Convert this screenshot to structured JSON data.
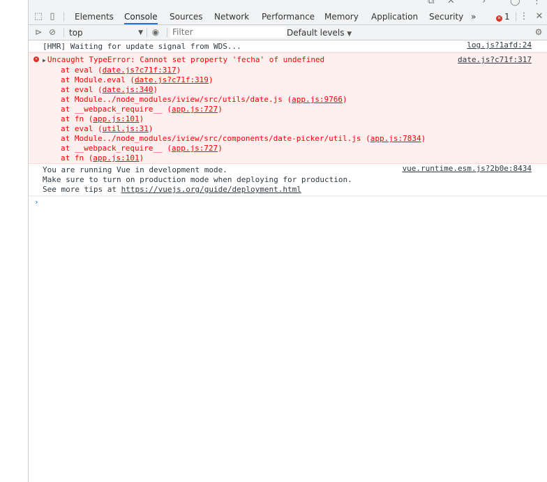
{
  "tabs": [
    "Elements",
    "Console",
    "Sources",
    "Network",
    "Performance",
    "Memory",
    "Application",
    "Security"
  ],
  "more_tabs": "»",
  "error_count": "1",
  "context": "top",
  "filter_placeholder": "Filter",
  "levels": "Default levels",
  "messages": {
    "hmr": {
      "text": "[HMR] Waiting for update signal from WDS...",
      "source": "log.js?1afd:24"
    },
    "error": {
      "text": "Uncaught TypeError: Cannot set property 'fecha' of undefined",
      "source": "date.js?c71f:317",
      "stack": [
        {
          "prefix": "at eval (",
          "link": "date.js?c71f:317",
          "suffix": ")"
        },
        {
          "prefix": "at Module.eval (",
          "link": "date.js?c71f:319",
          "suffix": ")"
        },
        {
          "prefix": "at eval (",
          "link": "date.js:340",
          "suffix": ")"
        },
        {
          "prefix": "at Module../node_modules/iview/src/utils/date.js (",
          "link": "app.js:9766",
          "suffix": ")"
        },
        {
          "prefix": "at __webpack_require__ (",
          "link": "app.js:727",
          "suffix": ")"
        },
        {
          "prefix": "at fn (",
          "link": "app.js:101",
          "suffix": ")"
        },
        {
          "prefix": "at eval (",
          "link": "util.js:31",
          "suffix": ")"
        },
        {
          "prefix": "at Module../node_modules/iview/src/components/date-picker/util.js (",
          "link": "app.js:7834",
          "suffix": ")"
        },
        {
          "prefix": "at __webpack_require__ (",
          "link": "app.js:727",
          "suffix": ")"
        },
        {
          "prefix": "at fn (",
          "link": "app.js:101",
          "suffix": ")"
        }
      ]
    },
    "vue": {
      "line1": "You are running Vue in development mode.",
      "line2": "Make sure to turn on production mode when deploying for production.",
      "line3_prefix": "See more tips at ",
      "line3_link": "https://vuejs.org/guide/deployment.html",
      "source": "vue.runtime.esm.js?2b0e:8434"
    }
  },
  "prompt": "›"
}
